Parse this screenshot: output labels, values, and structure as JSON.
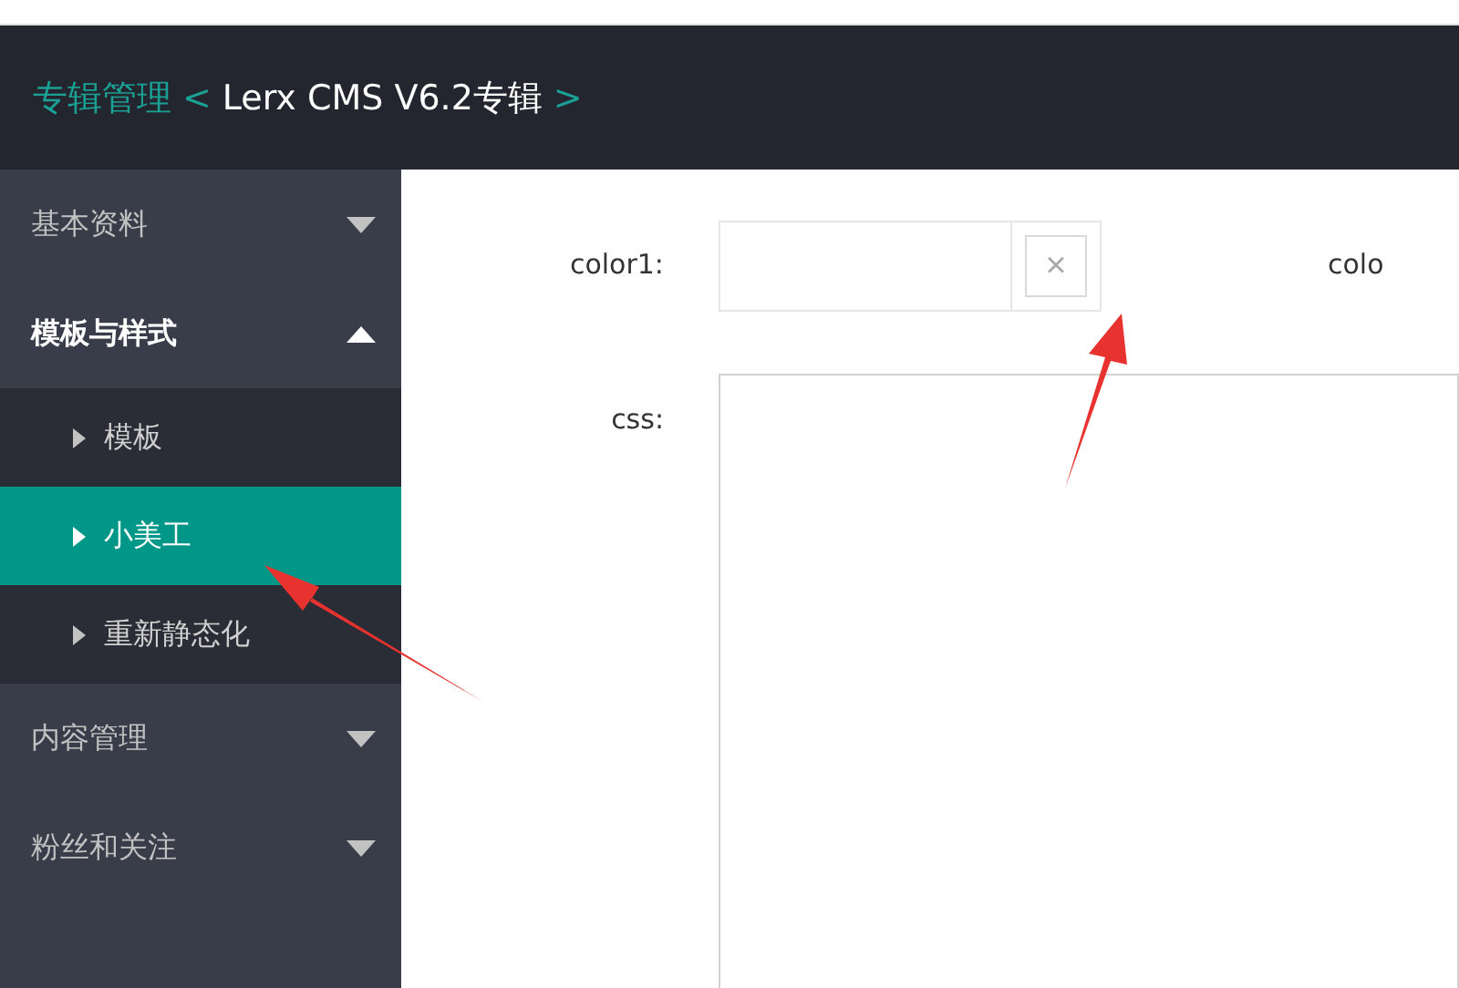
{
  "header": {
    "breadcrumb_root": "专辑管理",
    "separator_left": "<",
    "current": "Lerx CMS V6.2专辑",
    "separator_right": ">"
  },
  "sidebar": {
    "groups": [
      {
        "label": "基本资料",
        "expanded": false
      },
      {
        "label": "模板与样式",
        "expanded": true,
        "children": [
          {
            "label": "模板",
            "selected": false
          },
          {
            "label": "小美工",
            "selected": true
          },
          {
            "label": "重新静态化",
            "selected": false
          }
        ]
      },
      {
        "label": "内容管理",
        "expanded": false
      },
      {
        "label": "粉丝和关注",
        "expanded": false
      }
    ]
  },
  "form": {
    "color1": {
      "label": "color1:",
      "clear_button": "×"
    },
    "color2_label": "colo",
    "css": {
      "label": "css:"
    }
  }
}
